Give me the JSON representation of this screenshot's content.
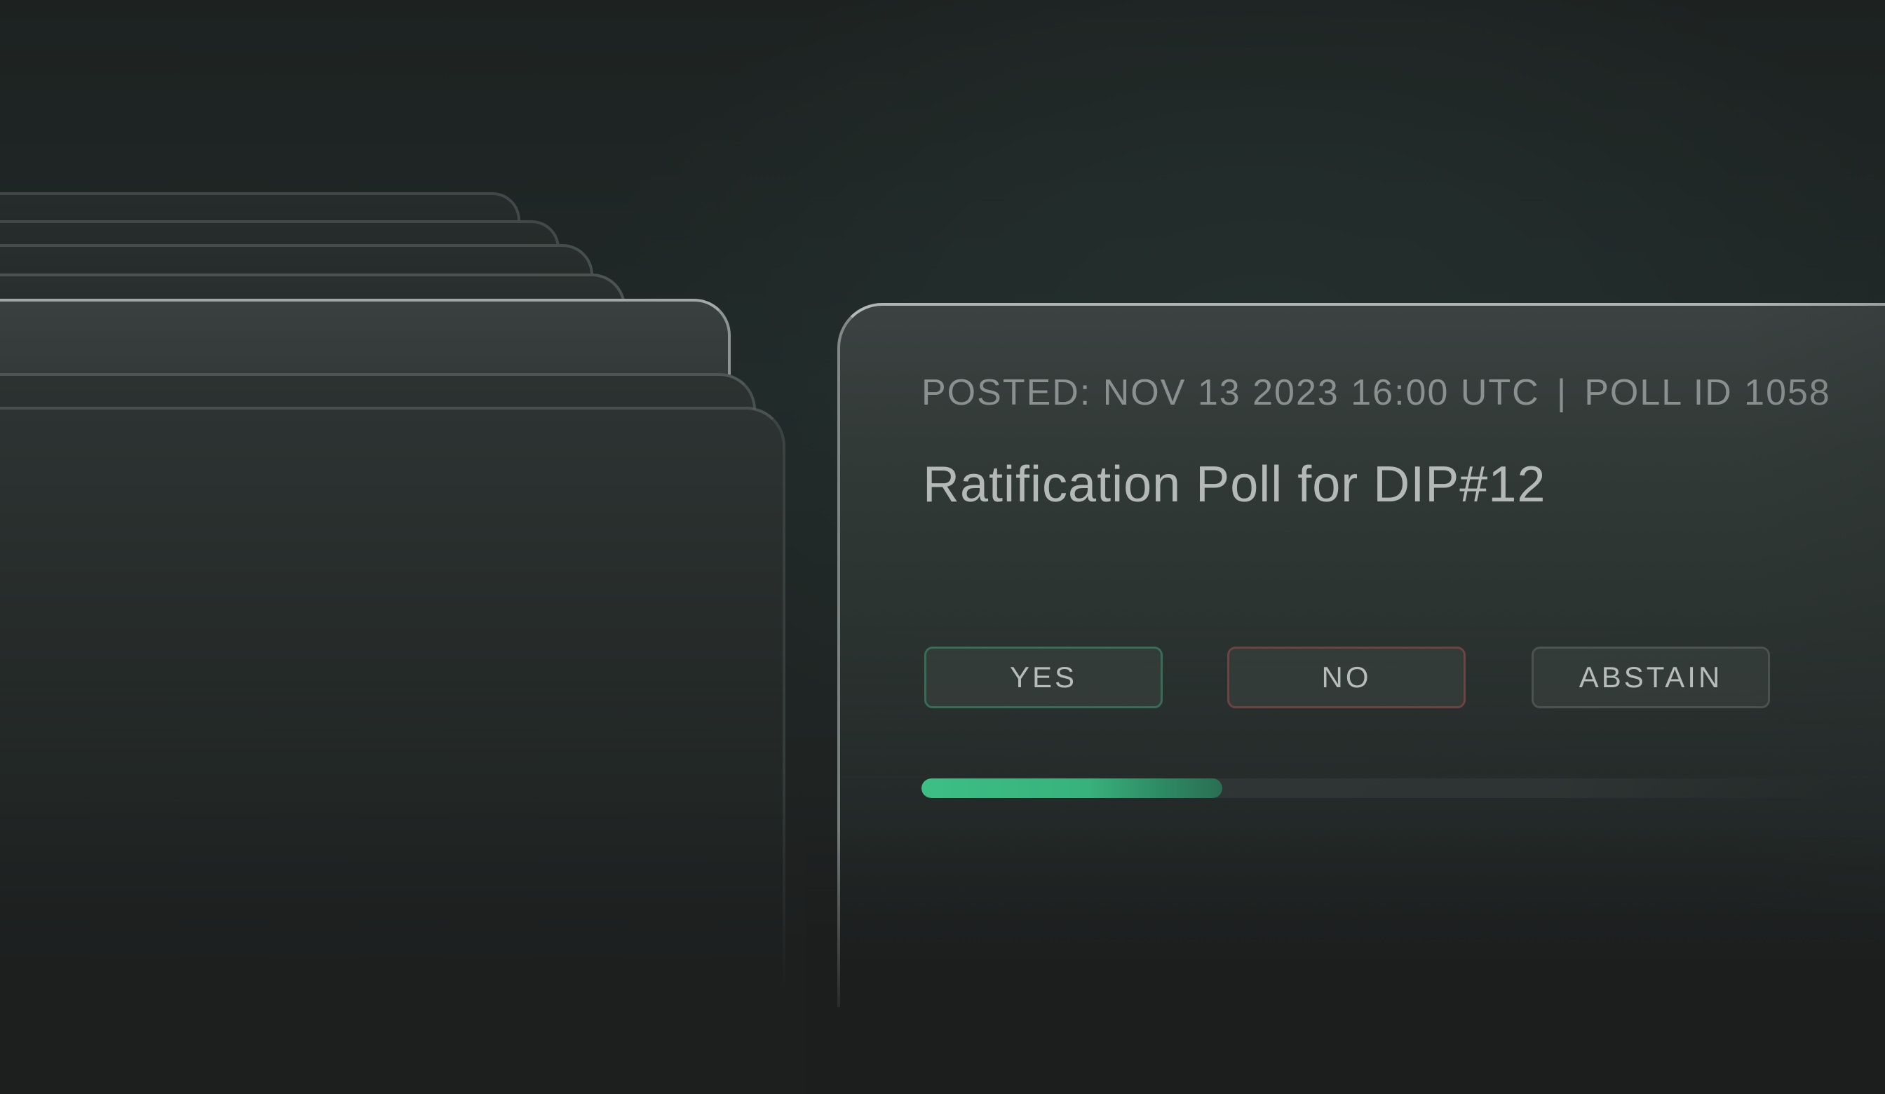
{
  "poll": {
    "posted": "POSTED: NOV 13 2023 16:00 UTC",
    "separator": "|",
    "poll_id": "POLL ID 1058",
    "title": "Ratification Poll for DIP#12",
    "options": {
      "yes": "YES",
      "no": "NO",
      "abstain": "ABSTAIN"
    },
    "progress": 0.33
  },
  "colors": {
    "accent_green": "#3cbf85",
    "yes_border": "#3e9670",
    "no_border": "#964848",
    "background": "#1f2423"
  }
}
